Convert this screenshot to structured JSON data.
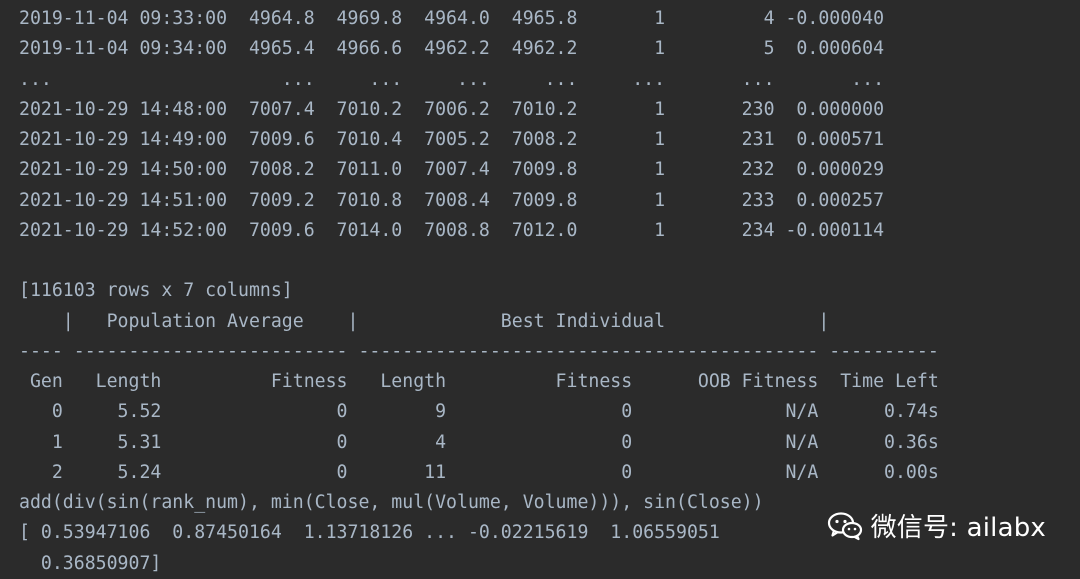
{
  "console": {
    "lines": [
      "2019-11-04 09:33:00  4964.8  4969.8  4964.0  4965.8       1         4 -0.000040",
      "2019-11-04 09:34:00  4965.4  4966.6  4962.2  4962.2       1         5  0.000604",
      "...                     ...     ...     ...     ...     ...       ...       ...",
      "2021-10-29 14:48:00  7007.4  7010.2  7006.2  7010.2       1       230  0.000000",
      "2021-10-29 14:49:00  7009.6  7010.4  7005.2  7008.2       1       231  0.000571",
      "2021-10-29 14:50:00  7008.2  7011.0  7007.4  7009.8       1       232  0.000029",
      "2021-10-29 14:51:00  7009.2  7010.8  7008.4  7009.8       1       233  0.000257",
      "2021-10-29 14:52:00  7009.6  7014.0  7008.8  7012.0       1       234 -0.000114",
      "",
      "[116103 rows x 7 columns]",
      "    |   Population Average    |             Best Individual              |",
      "---- ------------------------- ------------------------------------------ ----------",
      " Gen   Length          Fitness   Length          Fitness      OOB Fitness  Time Left",
      "   0     5.52                0        9                0              N/A      0.74s",
      "   1     5.31                0        4                0              N/A      0.36s",
      "   2     5.24                0       11                0              N/A      0.00s",
      "add(div(sin(rank_num), min(Close, mul(Volume, Volume))), sin(Close))",
      "[ 0.53947106  0.87450164  1.13718126 ... -0.02215619  1.06559051",
      "  0.36850907]"
    ]
  },
  "watermark": {
    "icon": "wechat-icon",
    "text": "微信号: ailabx"
  },
  "colors": {
    "background": "#2b2b2b",
    "text": "#a9b7c6",
    "watermark": "#ffffff"
  }
}
